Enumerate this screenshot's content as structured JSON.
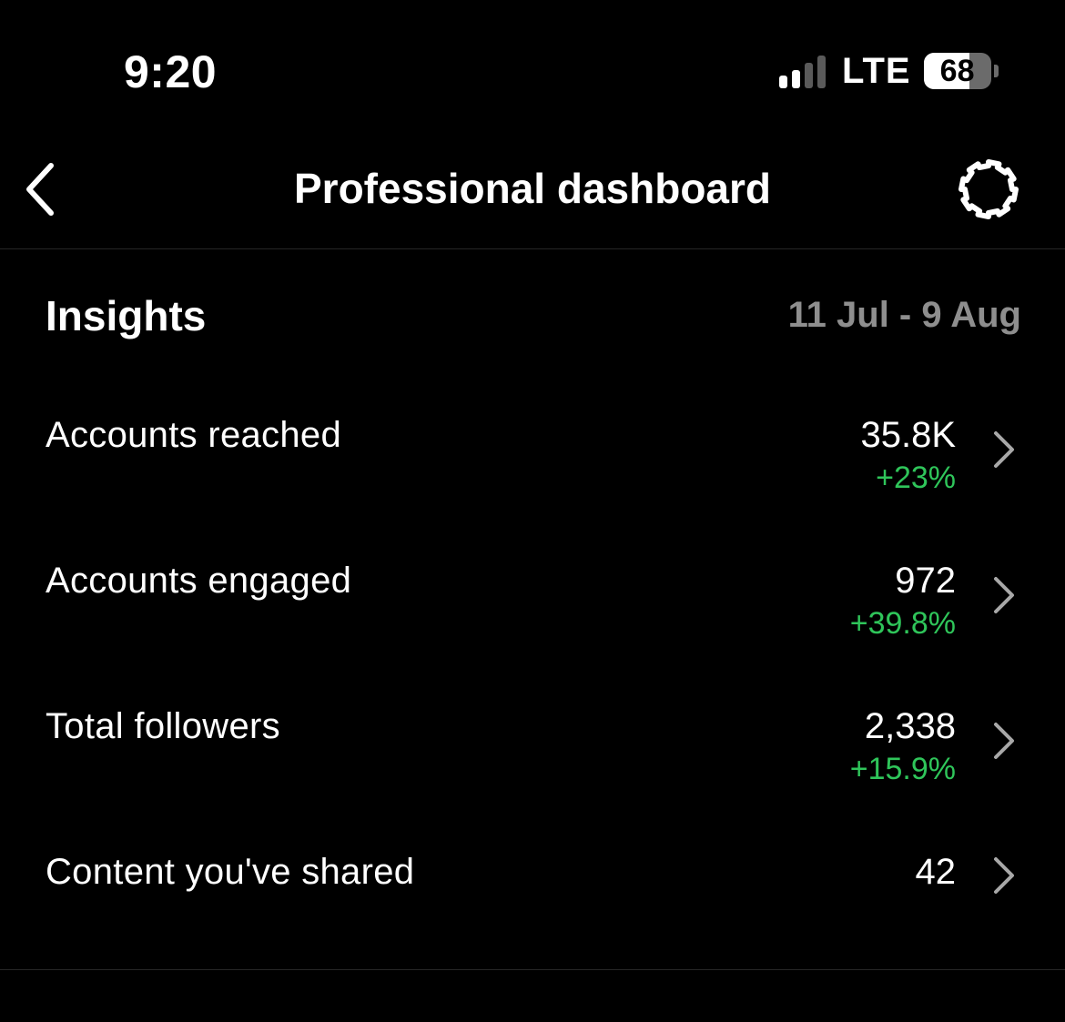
{
  "status_bar": {
    "time": "9:20",
    "network": "LTE",
    "battery_level": "68",
    "signal_bars_active": 2,
    "signal_bars_total": 4
  },
  "header": {
    "title": "Professional dashboard",
    "back_icon": "chevron-left-icon",
    "settings_icon": "gear-icon"
  },
  "insights": {
    "title": "Insights",
    "date_range": "11 Jul - 9 Aug",
    "metrics": [
      {
        "label": "Accounts reached",
        "value": "35.8K",
        "change": "+23%"
      },
      {
        "label": "Accounts engaged",
        "value": "972",
        "change": "+39.8%"
      },
      {
        "label": "Total followers",
        "value": "2,338",
        "change": "+15.9%"
      },
      {
        "label": "Content you've shared",
        "value": "42",
        "change": ""
      }
    ]
  },
  "colors": {
    "background": "#000000",
    "text_primary": "#ffffff",
    "text_secondary": "#8e8e8e",
    "positive_change": "#2fc55a",
    "chevron": "#a8a8a8",
    "divider": "#262626"
  }
}
